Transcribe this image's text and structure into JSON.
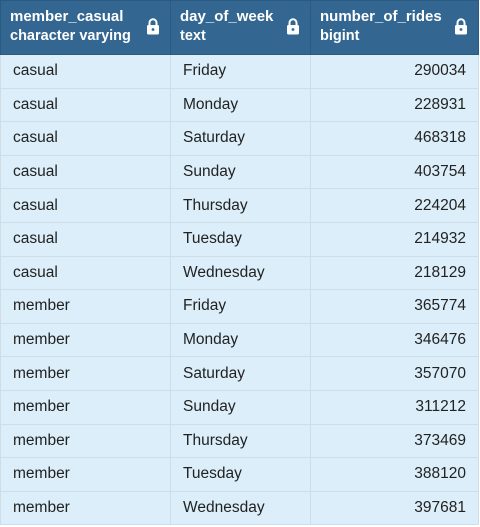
{
  "columns": [
    {
      "name": "member_casual",
      "type": "character varying",
      "icon": "lock-icon"
    },
    {
      "name": "day_of_week",
      "type": "text",
      "icon": "lock-icon"
    },
    {
      "name": "number_of_rides",
      "type": "bigint",
      "icon": "lock-icon"
    }
  ],
  "rows": [
    [
      "casual",
      "Friday",
      "290034"
    ],
    [
      "casual",
      "Monday",
      "228931"
    ],
    [
      "casual",
      "Saturday",
      "468318"
    ],
    [
      "casual",
      "Sunday",
      "403754"
    ],
    [
      "casual",
      "Thursday",
      "224204"
    ],
    [
      "casual",
      "Tuesday",
      "214932"
    ],
    [
      "casual",
      "Wednesday",
      "218129"
    ],
    [
      "member",
      "Friday",
      "365774"
    ],
    [
      "member",
      "Monday",
      "346476"
    ],
    [
      "member",
      "Saturday",
      "357070"
    ],
    [
      "member",
      "Sunday",
      "311212"
    ],
    [
      "member",
      "Thursday",
      "373469"
    ],
    [
      "member",
      "Tuesday",
      "388120"
    ],
    [
      "member",
      "Wednesday",
      "397681"
    ]
  ],
  "colors": {
    "header_bg": "#336791",
    "cell_bg": "#dbeef9",
    "grid_line": "#cfdde8"
  }
}
